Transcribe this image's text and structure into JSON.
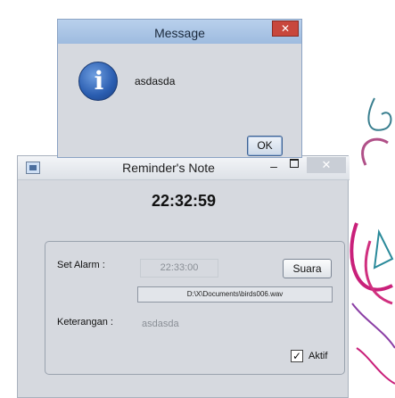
{
  "dialog": {
    "title": "Message",
    "close_glyph": "✕",
    "message": "asdasda",
    "ok_label": "OK",
    "icon": "info-icon",
    "info_glyph": "i"
  },
  "reminder": {
    "title": "Reminder's Note",
    "minimize_glyph": "–",
    "close_glyph": "✕",
    "clock": "22:32:59",
    "alarm_label": "Set Alarm :",
    "alarm_value": "22:33:00",
    "sound_button": "Suara",
    "sound_path": "D:\\X\\Documents\\birds006.wav",
    "note_label": "Keterangan :",
    "note_value": "asdasda",
    "active_label": "Aktif",
    "active_checked": true,
    "check_glyph": "✓"
  },
  "colors": {
    "window_bg": "#d6d9df",
    "dialog_title": "#9ebbdf",
    "close_red": "#c8473d",
    "art_pink": "#d0307f",
    "art_teal": "#2a8a9a"
  }
}
